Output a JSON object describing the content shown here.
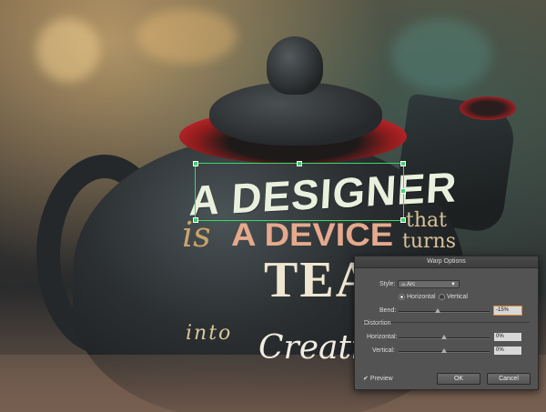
{
  "artwork": {
    "line1": "A DESIGNER",
    "line2_is": "is",
    "line2": "A DEVICE",
    "line2_that": "that",
    "line2_turns": "turns",
    "line3": "TEA",
    "line4_into": "into",
    "line4": "Creativ"
  },
  "dialog": {
    "title": "Warp Options",
    "style_label": "Style:",
    "style_value": "Arc",
    "style_icon": "arc-icon",
    "orientation_horizontal": "Horizontal",
    "orientation_vertical": "Vertical",
    "orientation_selected": "Horizontal",
    "bend_label": "Bend:",
    "bend_value": "-15%",
    "bend_level": -15,
    "distortion_label": "Distortion",
    "horizontal_label": "Horizontal:",
    "horizontal_value": "0%",
    "horizontal_level": 0,
    "vertical_label": "Vertical:",
    "vertical_value": "0%",
    "vertical_level": 0,
    "preview_label": "Preview",
    "preview_checked": true,
    "ok_label": "OK",
    "cancel_label": "Cancel"
  },
  "colors": {
    "selection": "#3cd66a",
    "dialog_bg": "#535353",
    "focus": "#e08a2a"
  }
}
